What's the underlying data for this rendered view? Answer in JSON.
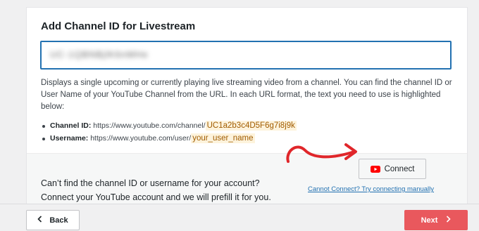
{
  "card": {
    "title": "Add Channel ID for Livestream",
    "input_value": "UC-1QBNBjlK6nMHe",
    "description": "Displays a single upcoming or currently playing live streaming video from a channel. You can find the channel ID or User Name of your YouTube Channel from the URL. In each URL format, the text you need to use is highlighted below:",
    "bullets": [
      {
        "label": "Channel ID:",
        "url": "https://www.youtube.com/channel/",
        "highlight": "UC1a2b3c4D5F6g7i8j9k"
      },
      {
        "label": "Username:",
        "url": "https://www.youtube.com/user/",
        "highlight": "your_user_name"
      }
    ]
  },
  "footer": {
    "line1": "Can’t find the channel ID or username for your account?",
    "line2": "Connect your YouTube account and we will prefill it for you.",
    "connect_label": "Connect",
    "manual_link": "Cannot Connect? Try connecting manually"
  },
  "nav": {
    "back_label": "Back",
    "next_label": "Next"
  },
  "colors": {
    "accent_blue": "#2271b1",
    "next_red": "#e9585d",
    "youtube_red": "#ff0000",
    "highlight_bg": "#fdf3dc",
    "highlight_text": "#a15c00",
    "annotation_arrow": "#e0262a"
  },
  "icons": {
    "connect": "youtube-icon",
    "back": "chevron-left-icon",
    "next": "chevron-right-icon",
    "annotation": "curved-arrow-annotation"
  }
}
